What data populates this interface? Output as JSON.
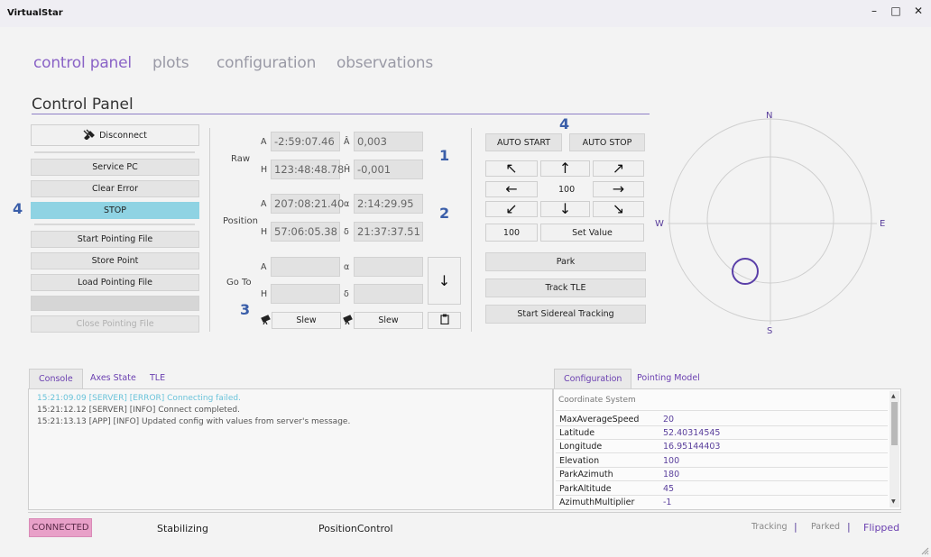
{
  "app": {
    "title": "VirtualStar"
  },
  "window": {
    "minimize": "–",
    "maximize": "□",
    "close": "✕"
  },
  "nav": [
    "control panel",
    "plots",
    "configuration",
    "observations"
  ],
  "page_title": "Control Panel",
  "left_buttons": {
    "disconnect": "Disconnect",
    "service_pc": "Service PC",
    "clear_error": "Clear Error",
    "stop": "STOP",
    "start_pointing": "Start Pointing File",
    "store_point": "Store Point",
    "load_pointing": "Load Pointing File",
    "close_pointing": "Close Pointing File"
  },
  "annotations": {
    "n1": "1",
    "n2": "2",
    "n3": "3",
    "n4a": "4",
    "n4b": "4"
  },
  "coords": {
    "raw_label": "Raw",
    "position_label": "Position",
    "goto_label": "Go To",
    "A": "A",
    "H": "H",
    "A_hat": "Â",
    "H_hat": "Ĥ",
    "alpha": "α",
    "delta": "δ",
    "raw_a": "-2:59:07.46",
    "raw_a_hat": "0,003",
    "raw_h": "123:48:48.78",
    "raw_h_hat": "-0,001",
    "pos_a": "207:08:21.40",
    "pos_alpha": "2:14:29.95",
    "pos_h": "57:06:05.38",
    "pos_delta": "21:37:37.51",
    "slew1": "Slew",
    "slew2": "Slew"
  },
  "motion": {
    "auto_start": "AUTO START",
    "auto_stop": "AUTO STOP",
    "step": "100",
    "value": "100",
    "set_value": "Set Value",
    "park": "Park",
    "track_tle": "Track TLE",
    "sidereal": "Start Sidereal Tracking"
  },
  "compass": {
    "n": "N",
    "s": "S",
    "e": "E",
    "w": "W"
  },
  "console_tabs": [
    "Console",
    "Axes State",
    "TLE"
  ],
  "console_lines": [
    "15:21:09.09 [SERVER] [ERROR] Connecting failed.",
    "15:21:12.12 [SERVER] [INFO] Connect completed.",
    "15:21:13.13 [APP] [INFO] Updated config with values from server's message."
  ],
  "config_tabs": [
    "Configuration",
    "Pointing Model"
  ],
  "config_header": "Coordinate System",
  "config_rows": [
    {
      "name": "MaxAverageSpeed",
      "value": "20"
    },
    {
      "name": "Latitude",
      "value": "52.40314545"
    },
    {
      "name": "Longitude",
      "value": "16.95144403"
    },
    {
      "name": "Elevation",
      "value": "100"
    },
    {
      "name": "ParkAzimuth",
      "value": "180"
    },
    {
      "name": "ParkAltitude",
      "value": "45"
    },
    {
      "name": "AzimuthMultiplier",
      "value": "-1"
    }
  ],
  "status": {
    "connected": "CONNECTED",
    "stabilizing": "Stabilizing",
    "mode": "PositionControl",
    "tracking": "Tracking",
    "sep1": "|",
    "parked": "Parked",
    "sep2": "|",
    "flipped": "Flipped"
  },
  "colors": {
    "accent": "#8a63c6",
    "stop": "#8fd3e3",
    "connected": "#e8a0c8",
    "annot": "#3a5ea9"
  }
}
